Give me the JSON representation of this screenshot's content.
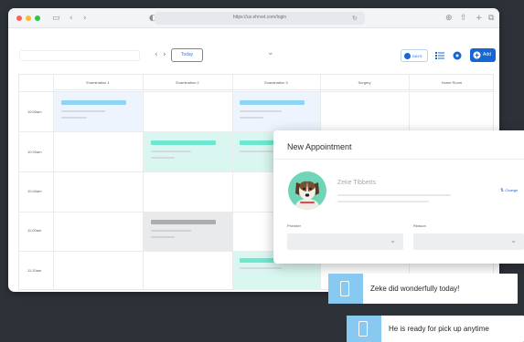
{
  "browser": {
    "url": "https://us.ehrvet.com/login"
  },
  "toolbar": {
    "today_label": "Today",
    "view_label": "DAYS",
    "add_label": "Add"
  },
  "calendar": {
    "columns": [
      "Examination 1",
      "Examination 2",
      "Examination 3",
      "Surgery",
      "Home Room"
    ],
    "times": [
      "10:00am",
      "10:20am",
      "10:40am",
      "11:00am",
      "11:20am"
    ]
  },
  "modal": {
    "title": "New Appointment",
    "patient_name": "Zeke Tibbetts",
    "change_label": "Change",
    "provider_label": "Provider",
    "reason_label": "Reason"
  },
  "messages": [
    {
      "text": "Zeke did wonderfully today!"
    },
    {
      "text": "He is ready for pick up anytime"
    }
  ],
  "colors": {
    "accent": "#1766d6",
    "appointment_blue": "#8fd3f5",
    "appointment_teal": "#6fe7cf",
    "appointment_gray": "#a9adb2",
    "message_icon": "#87c9f0",
    "background": "#2d3238"
  }
}
